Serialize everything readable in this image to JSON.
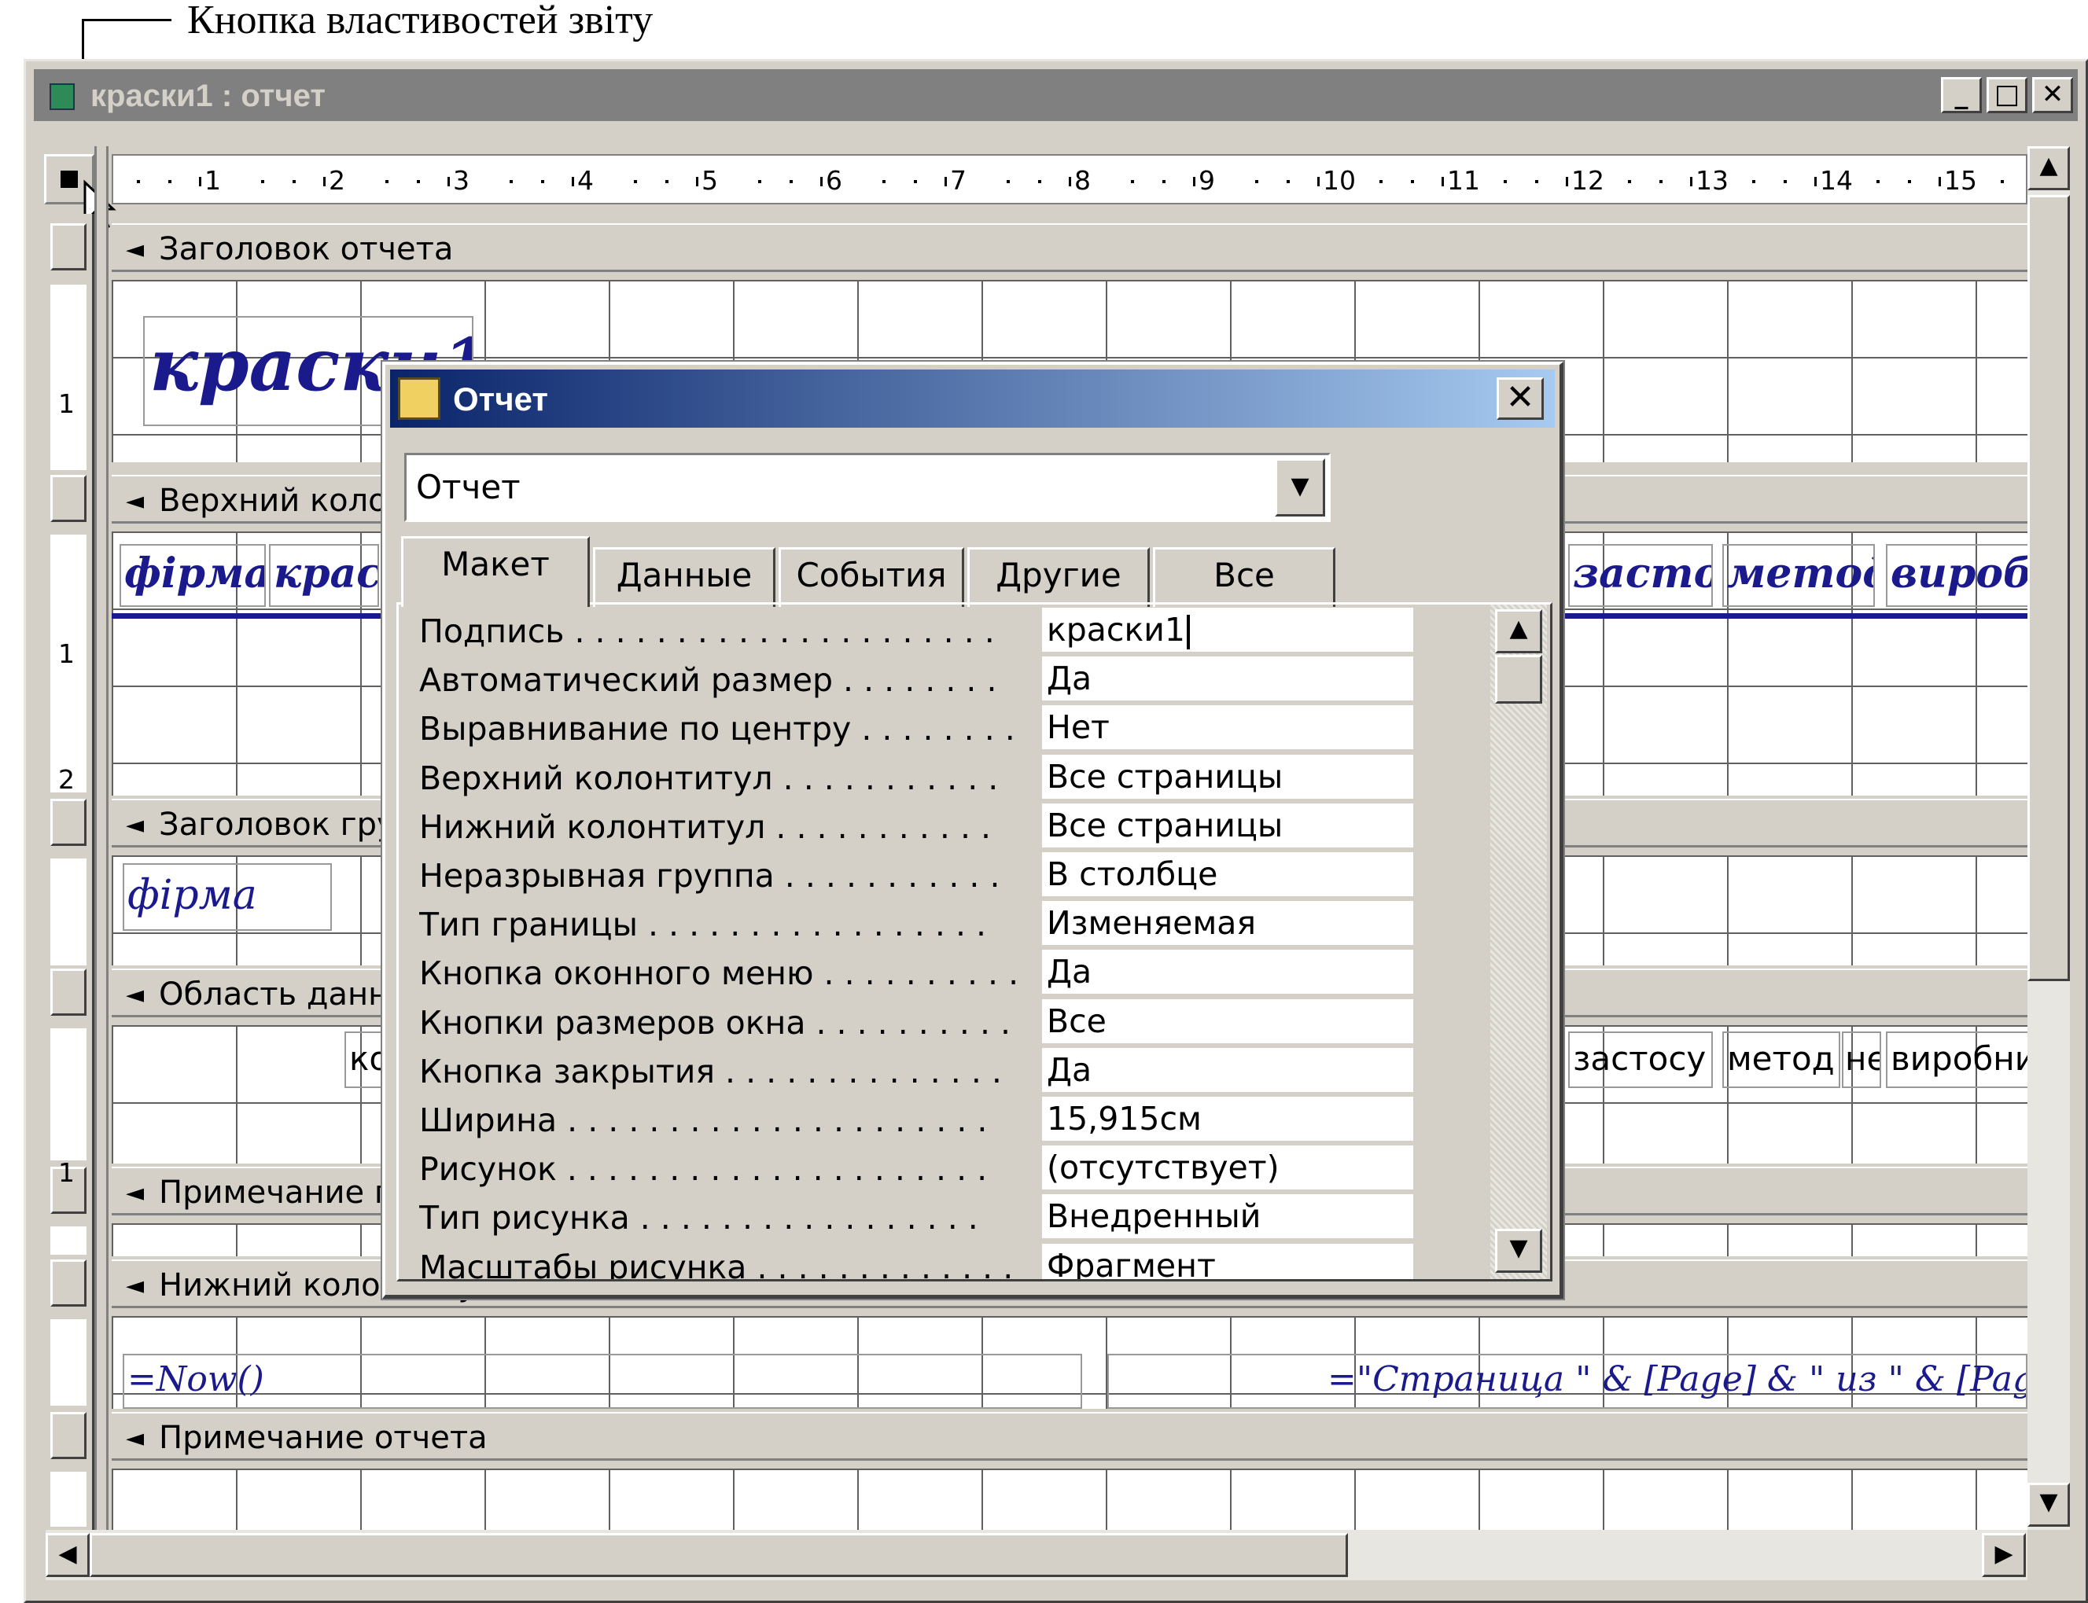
{
  "caption": "Кнопка властивостей звіту",
  "window": {
    "title": "краски1 : отчет",
    "minimize": "_",
    "maximize": "□",
    "close": "✕"
  },
  "ruler": {
    "h_numbers": [
      "1",
      "2",
      "3",
      "4",
      "5",
      "6",
      "7",
      "8",
      "9",
      "10",
      "11",
      "12",
      "13",
      "14",
      "15"
    ],
    "v_numbers_report_header": [
      "1"
    ],
    "v_numbers_page_header": [
      "1",
      "2"
    ],
    "v_numbers_detail": [
      "1"
    ]
  },
  "sections": {
    "report_header": "Заголовок отчета",
    "page_header": "Верхний колонтитул",
    "group_header": "Заголовок группы",
    "detail": "Область данных",
    "group_footer": "Примечание группы",
    "page_footer": "Нижний колонтитул",
    "report_footer": "Примечание отчета"
  },
  "controls": {
    "report_title": "краски1",
    "header_labels": [
      "фірма",
      "крас",
      "засто",
      "метод",
      "виробн"
    ],
    "group_field": "фірма",
    "detail_fields": [
      "кол",
      "застосу",
      "метод",
      "нє",
      "виробни"
    ],
    "footer_now": "=Now()",
    "footer_page": "=\"Страница \" & [Page] & \" из \" & [Pages]"
  },
  "dialog": {
    "title": "Отчет",
    "selector_value": "Отчет",
    "tabs": [
      "Макет",
      "Данные",
      "События",
      "Другие",
      "Все"
    ],
    "active_tab": "Макет",
    "properties": [
      {
        "name": "Подпись . . . . . . . . . . . . . . . . . . . . .",
        "value": "краски1"
      },
      {
        "name": "Автоматический размер . . . . . . . .",
        "value": "Да"
      },
      {
        "name": "Выравнивание по центру . . . . . . . .",
        "value": "Нет"
      },
      {
        "name": "Верхний колонтитул . . . . . . . . . . .",
        "value": "Все страницы"
      },
      {
        "name": "Нижний колонтитул . . . . . . . . . . .",
        "value": "Все страницы"
      },
      {
        "name": "Неразрывная группа . . . . . . . . . . .",
        "value": "В столбце"
      },
      {
        "name": "Тип границы . . . . . . . . . . . . . . . . .",
        "value": "Изменяемая"
      },
      {
        "name": "Кнопка оконного меню . . . . . . . . . .",
        "value": "Да"
      },
      {
        "name": "Кнопки размеров окна . . . . . . . . . .",
        "value": "Все"
      },
      {
        "name": "Кнопка закрытия . . . . . . . . . . . . . .",
        "value": "Да"
      },
      {
        "name": "Ширина . . . . . . . . . . . . . . . . . . . . .",
        "value": "15,915см"
      },
      {
        "name": "Рисунок . . . . . . . . . . . . . . . . . . . . .",
        "value": "(отсутствует)"
      },
      {
        "name": "Тип рисунка . . . . . . . . . . . . . . . . .",
        "value": "Внедренный"
      },
      {
        "name": "Масштабы рисунка . . . . . . . . . . . . .",
        "value": "Фрагмент"
      }
    ]
  }
}
